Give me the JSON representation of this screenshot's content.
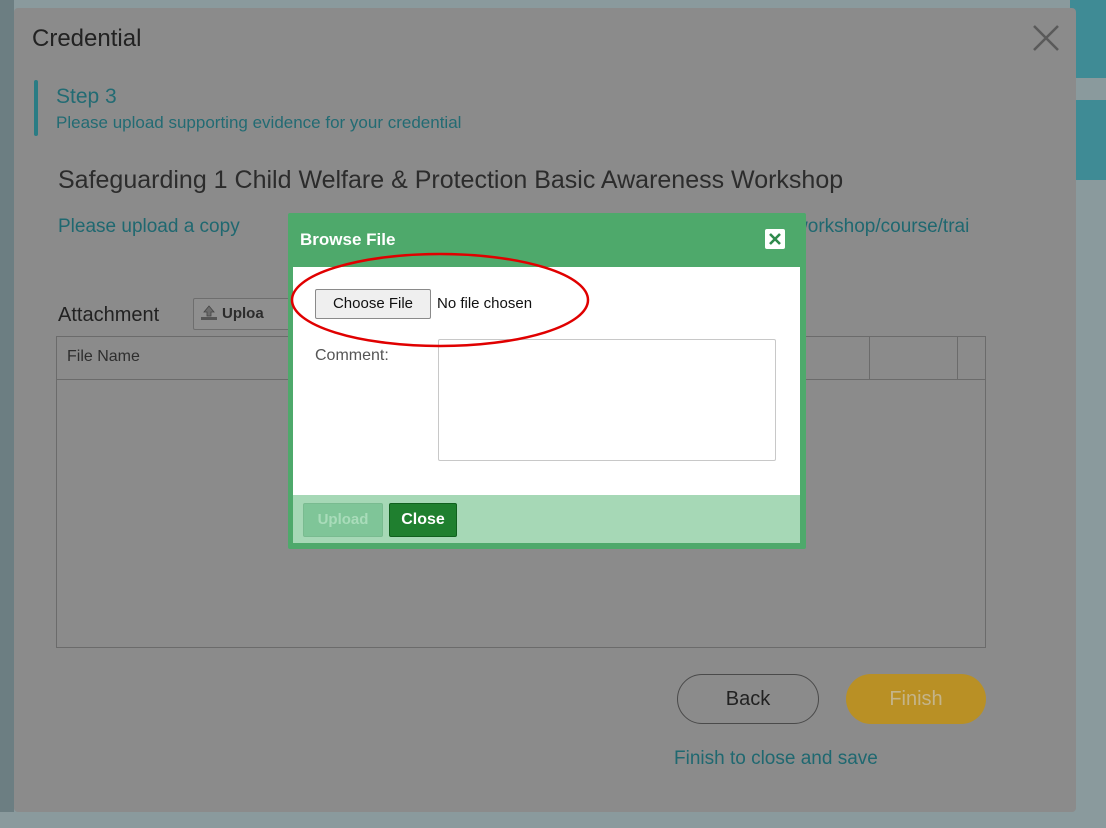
{
  "modal": {
    "title": "Credential",
    "step_title": "Step 3",
    "step_subtitle": "Please upload supporting evidence for your credential",
    "course_title": "Safeguarding 1 Child Welfare & Protection Basic Awareness Workshop",
    "instructions": "Please upload a copy                                                                              ended a specific workshop/course/trai",
    "attachment_label": "Attachment",
    "upload_button_label": "Uploa",
    "grid_columns": [
      "File Name"
    ],
    "back_label": "Back",
    "finish_label": "Finish",
    "finish_note": "Finish to close and save"
  },
  "dialog": {
    "title": "Browse File",
    "choose_file_label": "Choose File",
    "no_file_text": "No file chosen",
    "comment_label": "Comment:",
    "comment_value": "",
    "upload_label": "Upload",
    "close_label": "Close"
  },
  "colors": {
    "overlay": "#8b8b8b",
    "teal": "#226b73",
    "dialog_green": "#4ea96b",
    "close_green": "#1f7f2f",
    "finish_gold": "#b99025",
    "highlight_red": "#e00000"
  },
  "icons": {
    "modal_close": "close-icon",
    "dialog_close": "close-box-icon",
    "upload": "upload-icon"
  }
}
